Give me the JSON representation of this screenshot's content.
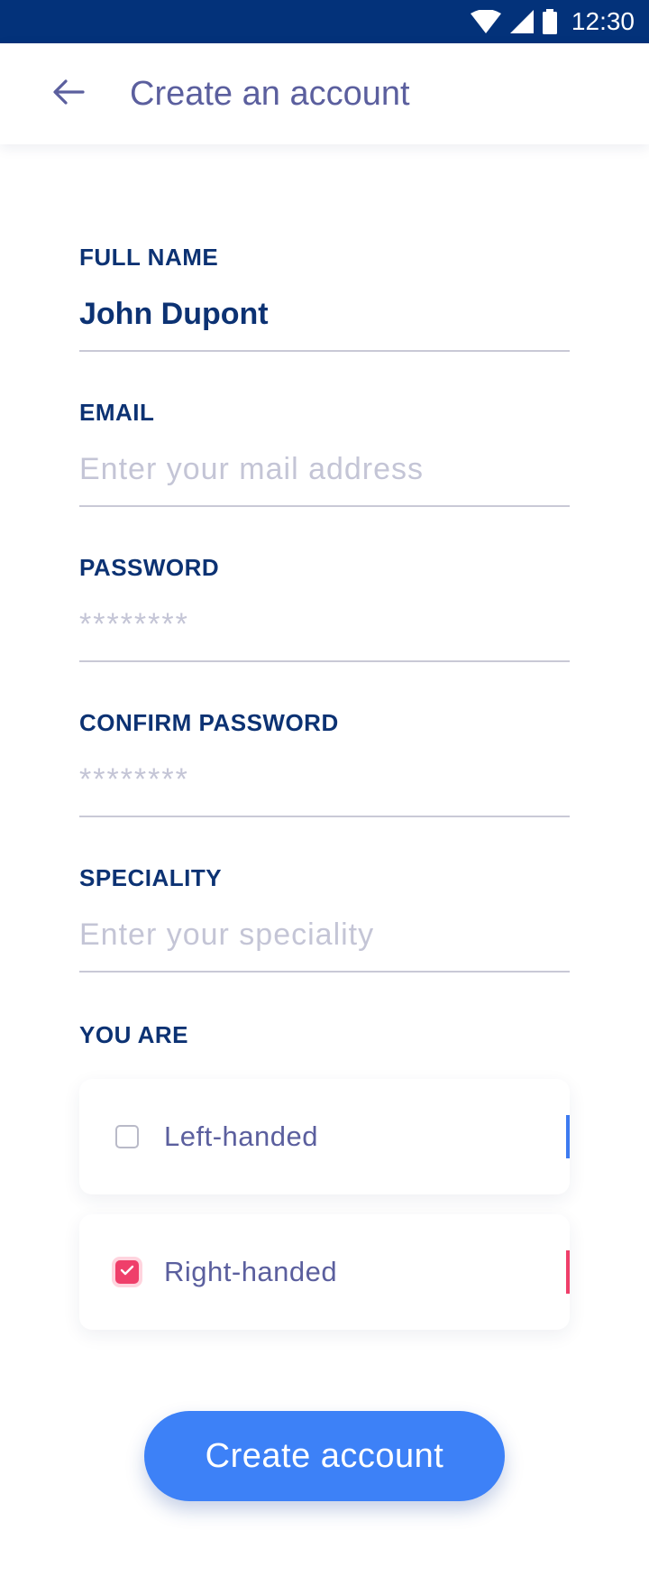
{
  "status_bar": {
    "time": "12:30",
    "icons": [
      "wifi-icon",
      "signal-icon",
      "battery-icon"
    ]
  },
  "app_bar": {
    "title": "Create an account",
    "back_icon": "arrow-left-icon"
  },
  "form": {
    "full_name": {
      "label": "FULL NAME",
      "value": "John Dupont",
      "placeholder": ""
    },
    "email": {
      "label": "EMAIL",
      "value": "",
      "placeholder": "Enter your mail address"
    },
    "password": {
      "label": "PASSWORD",
      "value": "",
      "placeholder": "********"
    },
    "confirm_password": {
      "label": "CONFIRM PASSWORD",
      "value": "",
      "placeholder": "********"
    },
    "speciality": {
      "label": "SPECIALITY",
      "value": "",
      "placeholder": "Enter your speciality"
    },
    "you_are": {
      "label": "YOU ARE",
      "options": [
        {
          "label": "Left-handed",
          "checked": false,
          "accent_color": "#3d7bf0"
        },
        {
          "label": "Right-handed",
          "checked": true,
          "accent_color": "#ef3f6a"
        }
      ]
    }
  },
  "cta": {
    "label": "Create account"
  },
  "colors": {
    "status_bar": "#03327a",
    "primary_text": "#0c3273",
    "secondary_text": "#5b5f9e",
    "cta": "#3d81f7",
    "checked": "#ef3f6a"
  }
}
